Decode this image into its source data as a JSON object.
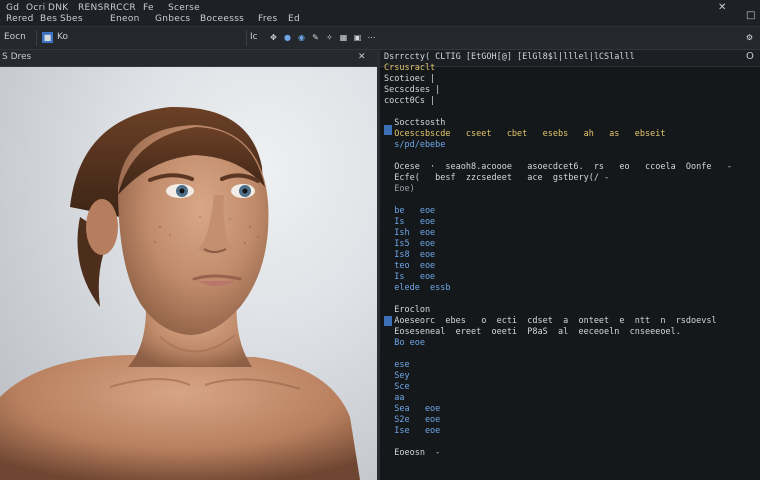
{
  "menubar": {
    "items": [
      "Gd",
      "Ocri",
      "DNK",
      "RENSRRCCR",
      "Fe",
      "Scerse"
    ],
    "items_row2": [
      "Rered",
      "Bes",
      "Sbes",
      "Eneon",
      "Gnbecs",
      "Boceesss",
      "Fres",
      "Ed"
    ],
    "win_controls": [
      "✕",
      "□"
    ]
  },
  "toolbar": {
    "left_label": "Eocn",
    "mid_label": "Ko",
    "right_label": "Ic"
  },
  "viewport": {
    "header_label": "S Dres"
  },
  "editor": {
    "header_right": "O",
    "lines": [
      {
        "text": "Dsrrccty( CLTIG [EtGOH[@] [ElGl8$l|lllel|lCSlalll",
        "cls": "c-white"
      },
      {
        "text": "Crsusraclt",
        "cls": "c-yellow"
      },
      {
        "text": "Scotioec |",
        "cls": "c-white"
      },
      {
        "text": "Secscdses |",
        "cls": "c-white"
      },
      {
        "text": "cocct0Cs |",
        "cls": "c-white"
      },
      {
        "text": "",
        "cls": "c-white"
      },
      {
        "text": "  Socctsosth",
        "cls": "c-white"
      },
      {
        "text": "  Ocescsbscde   cseet   cbet   esebs   ah   as   ebseit",
        "cls": "c-yellow"
      },
      {
        "text": "  s/pd/ebebe",
        "cls": "c-blue"
      },
      {
        "text": "",
        "cls": "c-white"
      },
      {
        "text": "  Ocese  ·  seaoh8.acoooe   asoecdcet6.  rs   eo   ccoela  Oonfe   -",
        "cls": "c-white"
      },
      {
        "text": "  Ecfe(   besf  zzcsedeet   ace  gstbery(/ -",
        "cls": "c-white"
      },
      {
        "text": "  Eoe)",
        "cls": "c-dim"
      },
      {
        "text": "",
        "cls": "c-white"
      },
      {
        "text": "  be   eoe",
        "cls": "c-blue"
      },
      {
        "text": "  Is   eoe",
        "cls": "c-blue"
      },
      {
        "text": "  Ish  eoe",
        "cls": "c-blue"
      },
      {
        "text": "  Is5  eoe",
        "cls": "c-blue"
      },
      {
        "text": "  Is8  eoe",
        "cls": "c-blue"
      },
      {
        "text": "  teo  eoe",
        "cls": "c-blue"
      },
      {
        "text": "  Is   eoe",
        "cls": "c-blue"
      },
      {
        "text": "  elede  essb",
        "cls": "c-blue"
      },
      {
        "text": "",
        "cls": "c-white"
      },
      {
        "text": "  Eroclon",
        "cls": "c-white"
      },
      {
        "text": "  Aoeseorc  ebes   o  ecti  cdset  a  onteet  e  ntt  n  rsdoevsl",
        "cls": "c-white"
      },
      {
        "text": "  Eoseseneal  ereet  oeeti  P8aS  al  eeceoeln  cnseeeoel.",
        "cls": "c-white"
      },
      {
        "text": "  Bo eoe",
        "cls": "c-blue"
      },
      {
        "text": "",
        "cls": "c-white"
      },
      {
        "text": "  ese",
        "cls": "c-blue"
      },
      {
        "text": "  Sey",
        "cls": "c-blue"
      },
      {
        "text": "  Sce",
        "cls": "c-blue"
      },
      {
        "text": "  aa",
        "cls": "c-blue"
      },
      {
        "text": "  Sea   eoe",
        "cls": "c-blue"
      },
      {
        "text": "  S2e   eoe",
        "cls": "c-blue"
      },
      {
        "text": "  Ise   eoe",
        "cls": "c-blue"
      },
      {
        "text": "",
        "cls": "c-white"
      },
      {
        "text": "  Eoeosn  -",
        "cls": "c-white"
      }
    ]
  }
}
